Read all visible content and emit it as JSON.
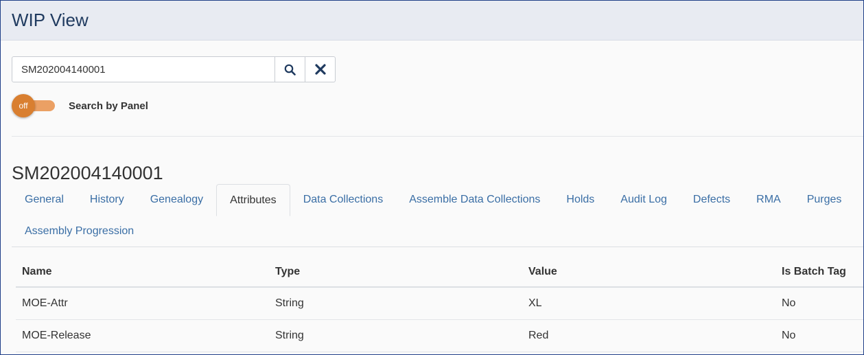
{
  "header": {
    "title": "WIP View"
  },
  "search": {
    "value": "SM202004140001",
    "search_icon": "search-icon",
    "clear_icon": "close-icon"
  },
  "toggle": {
    "state_label": "off",
    "label": "Search by Panel"
  },
  "serial": {
    "title": "SM202004140001"
  },
  "tabs": {
    "row1": [
      {
        "label": "General"
      },
      {
        "label": "History"
      },
      {
        "label": "Genealogy"
      },
      {
        "label": "Attributes",
        "active": true
      },
      {
        "label": "Data Collections"
      },
      {
        "label": "Assemble Data Collections"
      },
      {
        "label": "Holds"
      },
      {
        "label": "Audit Log"
      },
      {
        "label": "Defects"
      },
      {
        "label": "RMA"
      },
      {
        "label": "Purges"
      }
    ],
    "row2": [
      {
        "label": "Assembly Progression"
      }
    ]
  },
  "table": {
    "headers": [
      "Name",
      "Type",
      "Value",
      "Is Batch Tag"
    ],
    "rows": [
      [
        "MOE-Attr",
        "String",
        "XL",
        "No"
      ],
      [
        "MOE-Release",
        "String",
        "Red",
        "No"
      ]
    ]
  },
  "colors": {
    "accent": "#3a6ea5",
    "toggle_knob": "#d97f30",
    "toggle_track": "#eba064",
    "header_bg": "#e8ebf2",
    "frame_border": "#1f3f88"
  }
}
